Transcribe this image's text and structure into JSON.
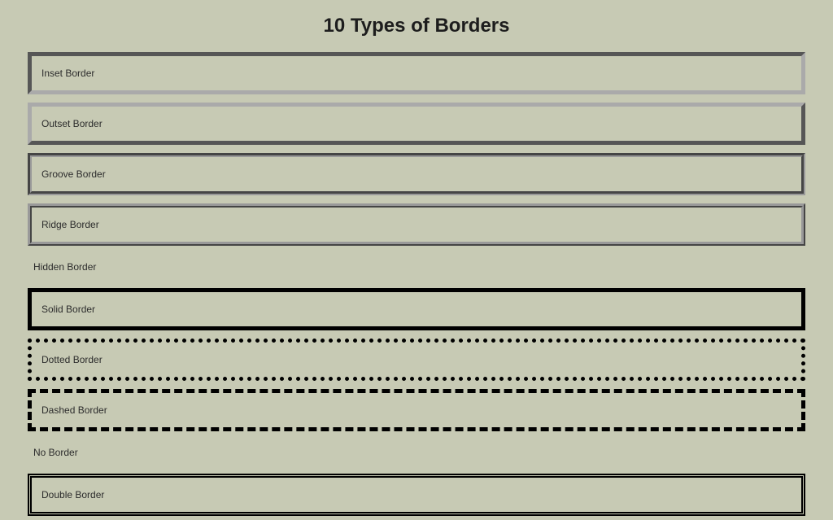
{
  "page": {
    "title": "10 Types of Borders"
  },
  "borders": {
    "inset": {
      "label": "Inset Border"
    },
    "outset": {
      "label": "Outset Border"
    },
    "groove": {
      "label": "Groove Border"
    },
    "ridge": {
      "label": "Ridge Border"
    },
    "hidden": {
      "label": "Hidden Border"
    },
    "solid": {
      "label": "Solid Border"
    },
    "dotted": {
      "label": "Dotted Border"
    },
    "dashed": {
      "label": "Dashed Border"
    },
    "none": {
      "label": "No Border"
    },
    "double": {
      "label": "Double Border"
    }
  }
}
